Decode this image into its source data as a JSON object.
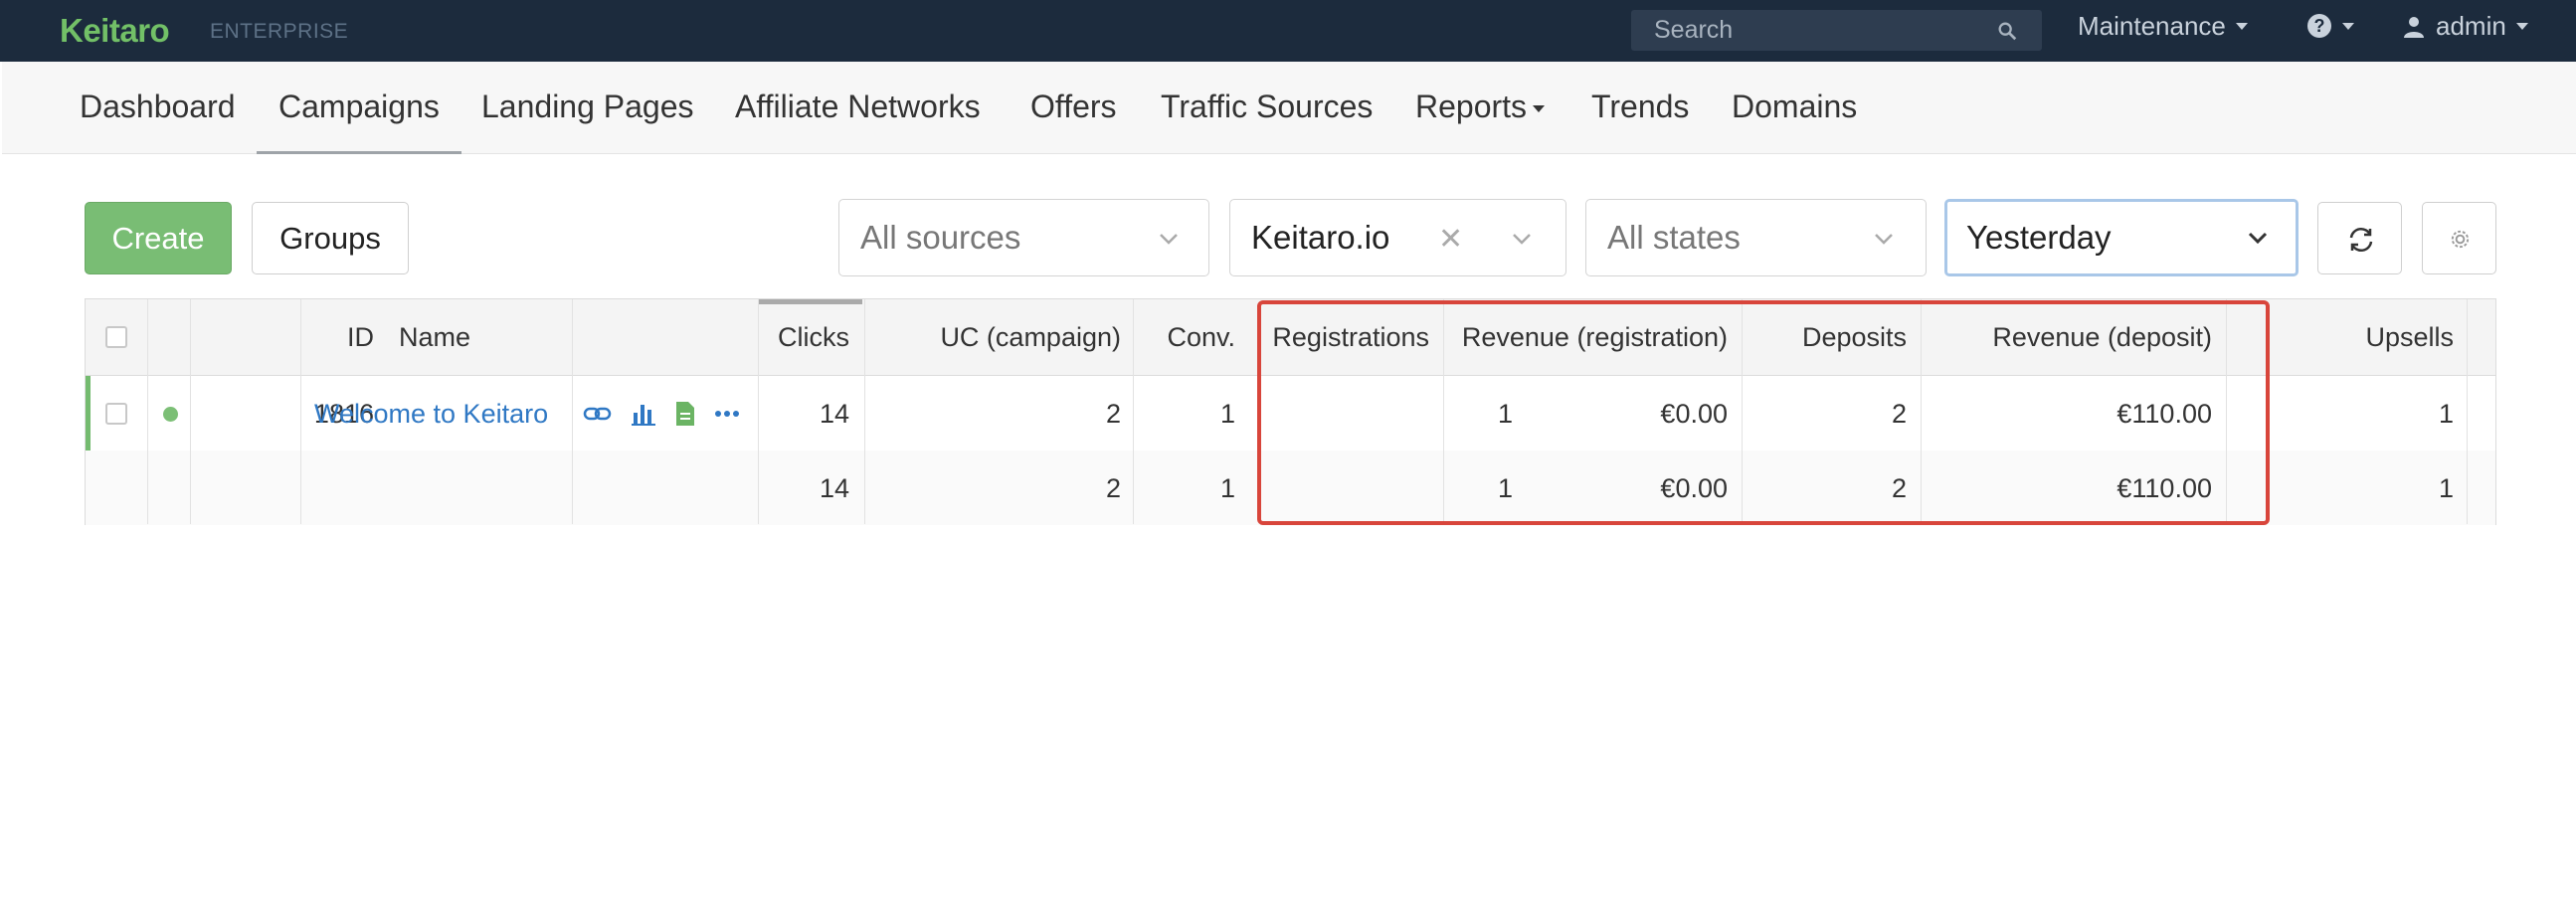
{
  "app": {
    "brand": "Keitaro",
    "edition": "ENTERPRISE"
  },
  "topbar": {
    "search_placeholder": "Search",
    "maintenance": "Maintenance",
    "help_icon": "question-circle-icon",
    "user": "admin"
  },
  "nav": {
    "items": [
      {
        "label": "Dashboard"
      },
      {
        "label": "Campaigns",
        "active": true
      },
      {
        "label": "Landing Pages"
      },
      {
        "label": "Affiliate Networks"
      },
      {
        "label": "Offers"
      },
      {
        "label": "Traffic Sources"
      },
      {
        "label": "Reports"
      },
      {
        "label": "Trends"
      },
      {
        "label": "Domains"
      }
    ]
  },
  "toolbar": {
    "create_label": "Create",
    "groups_label": "Groups",
    "sources_placeholder": "All sources",
    "workspace_value": "Keitaro.io",
    "states_placeholder": "All states",
    "date_value": "Yesterday"
  },
  "table": {
    "headers": {
      "id": "ID",
      "name": "Name",
      "clicks": "Clicks",
      "uc": "UC (campaign)",
      "conv": "Conv.",
      "registrations": "Registrations",
      "revenue_registration": "Revenue (registration)",
      "deposits": "Deposits",
      "revenue_deposit": "Revenue (deposit)",
      "upsells": "Upsells"
    },
    "rows": [
      {
        "id": "1816",
        "name": "Welcome to Keitaro",
        "clicks": "14",
        "uc": "2",
        "conv": "1",
        "registrations": "1",
        "revenue_registration": "€0.00",
        "deposits": "2",
        "revenue_deposit": "€110.00",
        "upsells": "1"
      }
    ],
    "totals": {
      "clicks": "14",
      "uc": "2",
      "conv": "1",
      "registrations": "1",
      "revenue_registration": "€0.00",
      "deposits": "2",
      "revenue_deposit": "€110.00",
      "upsells": "1"
    }
  },
  "colors": {
    "brand": "#72c067",
    "topbar": "#1c2b3d",
    "create": "#79bd74",
    "link": "#2f78c4",
    "highlight": "#d8453b"
  }
}
